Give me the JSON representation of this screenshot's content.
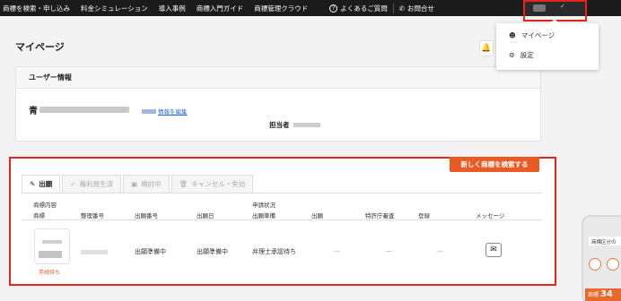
{
  "top_nav": {
    "items": [
      "商標を検索・申し込み",
      "料金シミュレーション",
      "導入事例",
      "商標入門ガイド",
      "商標管理クラウド"
    ],
    "faq_label": "よくあるご質問",
    "contact_label": "お問合せ"
  },
  "account_menu": {
    "items": [
      {
        "label": "マイページ",
        "icon": "person-icon"
      },
      {
        "label": "設定",
        "icon": "gear-icon"
      }
    ]
  },
  "page": {
    "title": "マイページ"
  },
  "user_info": {
    "heading": "ユーザー情報",
    "name_prefix": "青",
    "edit_link": "情報を編集",
    "representative_label": "担当者"
  },
  "cases": {
    "new_search_button": "新しく商標を検索する",
    "tabs": [
      {
        "label": "出願",
        "icon": "pencil-icon",
        "active": true
      },
      {
        "label": "権利発生済",
        "icon": "check-icon",
        "active": false
      },
      {
        "label": "検討中",
        "icon": "save-icon",
        "active": false
      },
      {
        "label": "キャンセル・失効",
        "icon": "trash-icon",
        "active": false
      }
    ],
    "header_groups": {
      "content": "商標内容",
      "status": "申請状況"
    },
    "columns": [
      "商標",
      "整理番号",
      "出願番号",
      "出願日",
      "出願準備",
      "出願",
      "特許庁審査",
      "登録",
      "メッセージ"
    ],
    "rows": [
      {
        "status_badge": "手続待ち",
        "application_number": "出願準備中",
        "application_date": "出願準備中",
        "prep_status": "弁理士承認待ち",
        "filing": "—",
        "examination": "—",
        "registration": "—"
      }
    ]
  },
  "side_ad": {
    "header": "商標区分の",
    "price_prefix": "商標",
    "price_value": "34"
  },
  "colors": {
    "accent": "#ea5a24",
    "nav_bg": "#1b1b1b",
    "highlight": "#e6241b",
    "link": "#2a6ad6"
  }
}
